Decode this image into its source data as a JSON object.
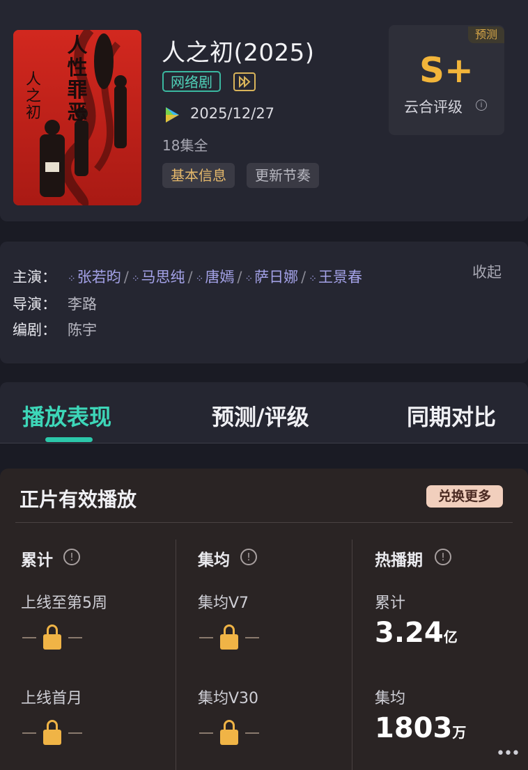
{
  "show": {
    "title": "人之初(2025)",
    "type_tag": "网络剧",
    "release_date": "2025/12/27",
    "episodes": "18集全",
    "chips": [
      "基本信息",
      "更新节奏"
    ],
    "poster_title": "人性罪恶",
    "poster_calligraphy": "人之初"
  },
  "rating": {
    "badge": "预测",
    "grade": "S+",
    "label": "云合评级",
    "info_icon": "ⓘ"
  },
  "credits": {
    "cast_label": "主演：",
    "cast": [
      "张若昀",
      "马思纯",
      "唐嫣",
      "萨日娜",
      "王景春"
    ],
    "director_label": "导演：",
    "director": "李路",
    "writer_label": "编剧：",
    "writer": "陈宇",
    "collapse": "收起"
  },
  "tabs": [
    "播放表现",
    "预测/评级",
    "同期对比"
  ],
  "stats": {
    "title": "正片有效播放",
    "switch_button": "兑换更多",
    "columns": [
      {
        "header": "累计",
        "items": [
          {
            "label": "上线至第5周",
            "locked": true
          },
          {
            "label": "上线首月",
            "locked": true
          }
        ]
      },
      {
        "header": "集均",
        "items": [
          {
            "label": "集均V7",
            "locked": true
          },
          {
            "label": "集均V30",
            "locked": true
          }
        ]
      },
      {
        "header": "热播期",
        "items": [
          {
            "label": "累计",
            "value": "3.24",
            "unit": "亿"
          },
          {
            "label": "集均",
            "value": "1803",
            "unit": "万"
          }
        ]
      }
    ],
    "info_icon": "!"
  },
  "colors": {
    "accent_teal": "#3dd6b8",
    "rating_gold": "#f2b53a",
    "cast_link": "#a4a2e8",
    "lock_gold": "#f0b446"
  }
}
